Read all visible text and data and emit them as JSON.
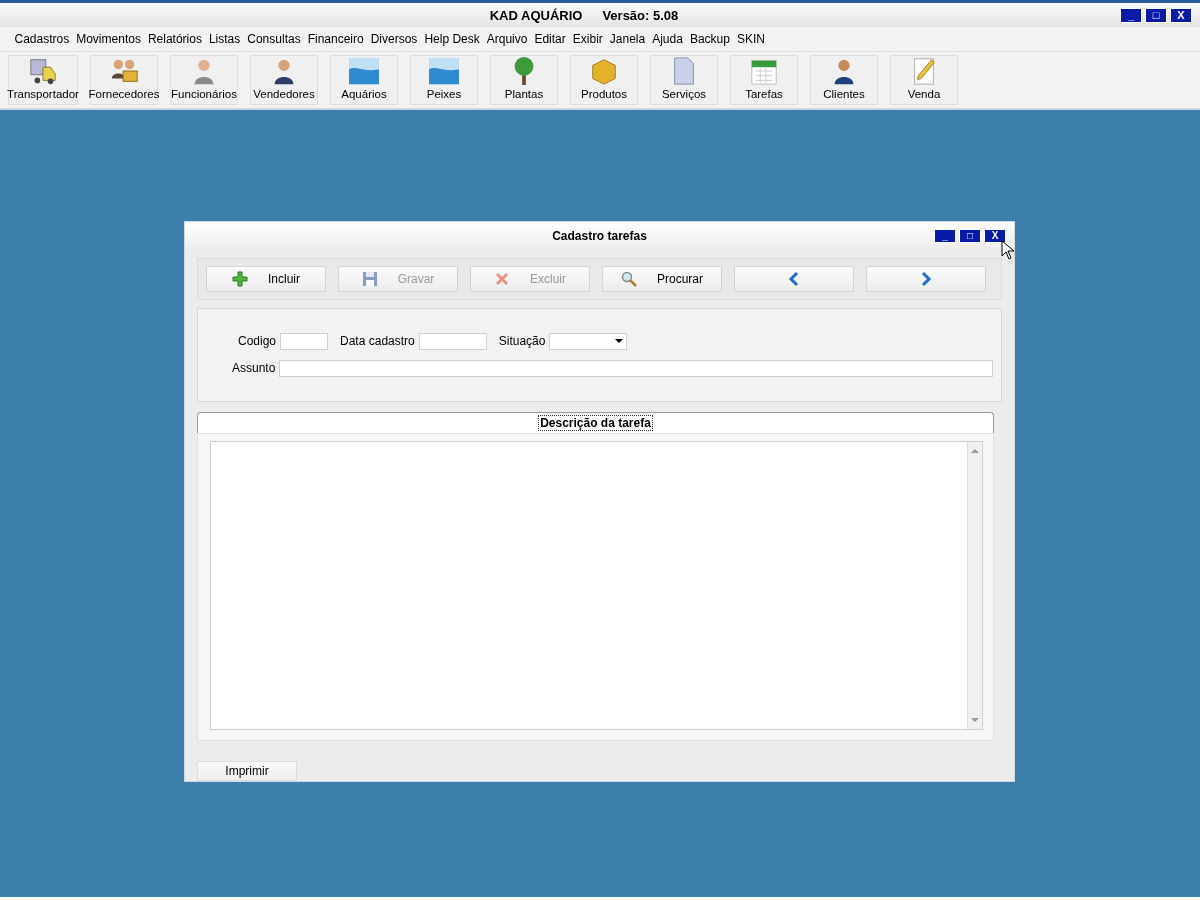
{
  "window": {
    "title": "KAD AQUÁRIO",
    "version": "Versão: 5.08",
    "controls": [
      "_",
      "□",
      "X"
    ]
  },
  "menu": [
    "Cadastros",
    "Movimentos",
    "Relatórios",
    "Listas",
    "Consultas",
    "Financeiro",
    "Diversos",
    "Help Desk",
    "Arquivo",
    "Editar",
    "Exibir",
    "Janela",
    "Ajuda",
    "Backup",
    "SKIN"
  ],
  "toolbar": [
    {
      "label": "Transportador"
    },
    {
      "label": "Fornecedores"
    },
    {
      "label": "Funcionários"
    },
    {
      "label": "Vendedores"
    },
    {
      "label": "Aquários"
    },
    {
      "label": "Peixes"
    },
    {
      "label": "Plantas"
    },
    {
      "label": "Produtos"
    },
    {
      "label": "Serviços"
    },
    {
      "label": "Tarefas"
    },
    {
      "label": "Clientes"
    },
    {
      "label": "Venda"
    }
  ],
  "child_window": {
    "title": "Cadastro tarefas",
    "controls": [
      "_",
      "□",
      "X"
    ],
    "actions": [
      {
        "kind": "add",
        "label": "Incluir",
        "disabled": false
      },
      {
        "kind": "save",
        "label": "Gravar",
        "disabled": true
      },
      {
        "kind": "delete",
        "label": "Excluir",
        "disabled": true
      },
      {
        "kind": "search",
        "label": "Procurar",
        "disabled": false
      },
      {
        "kind": "prev",
        "disabled": false
      },
      {
        "kind": "next",
        "disabled": false
      }
    ],
    "fields": {
      "codigo": {
        "label": "Codigo"
      },
      "data_cadastro": {
        "label": "Data cadastro"
      },
      "situacao": {
        "label": "Situação"
      },
      "assunto": {
        "label": "Assunto"
      }
    },
    "tabs": [
      {
        "label": "Descrição da tarefa",
        "selected": true
      }
    ],
    "print_button": "Imprimir"
  }
}
